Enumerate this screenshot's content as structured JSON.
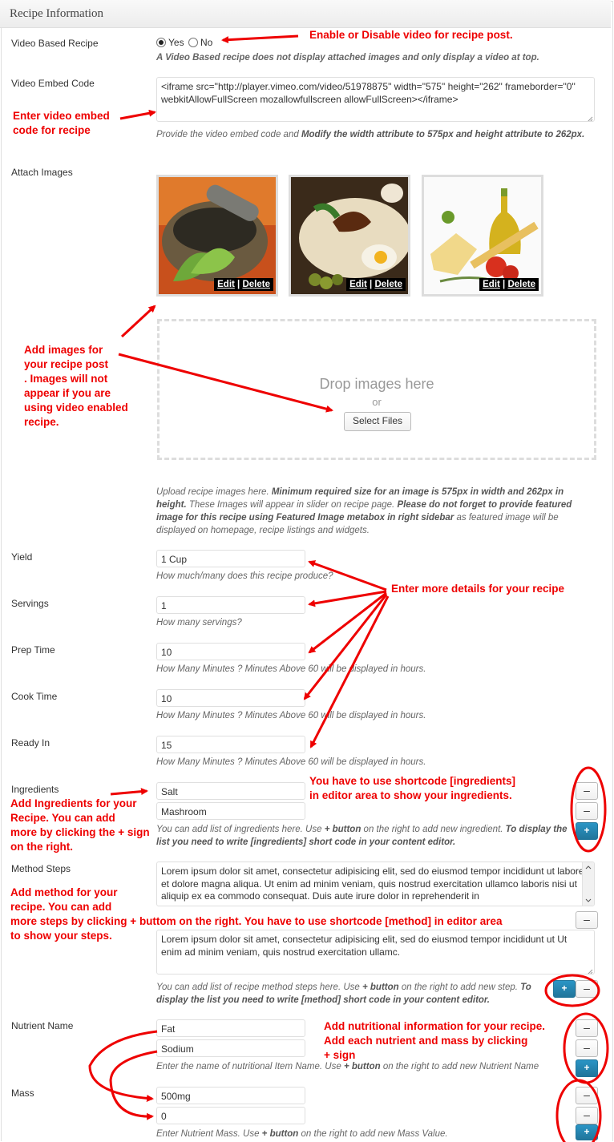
{
  "panel": {
    "title": "Recipe Information"
  },
  "video_based": {
    "label": "Video Based Recipe",
    "yes": "Yes",
    "no": "No",
    "desc": "A Video Based recipe does not display attached images and only display a video at top."
  },
  "embed": {
    "label": "Video Embed Code",
    "value": "<iframe src=\"http://player.vimeo.com/video/51978875\" width=\"575\" height=\"262\" frameborder=\"0\" webkitAllowFullScreen mozallowfullscreen allowFullScreen></iframe>",
    "desc_a": "Provide the video embed code and ",
    "desc_b": "Modify the width attribute to 575px and height attribute to 262px."
  },
  "images": {
    "label": "Attach Images",
    "edit": "Edit",
    "sep": " | ",
    "delete": "Delete",
    "drop_title": "Drop images here",
    "drop_or": "or",
    "select_files": "Select Files",
    "desc_a": "Upload recipe images here. ",
    "desc_b": "Minimum required size for an image is 575px in width and 262px in height.",
    "desc_c": " These Images will appear in slider on recipe page. ",
    "desc_d": "Please do not forget to provide featured image for this recipe using Featured Image metabox in right sidebar",
    "desc_e": " as featured image will be displayed on homepage, recipe listings and widgets."
  },
  "yield": {
    "label": "Yield",
    "value": "1 Cup",
    "desc": "How much/many does this recipe produce?"
  },
  "servings": {
    "label": "Servings",
    "value": "1",
    "desc": "How many servings?"
  },
  "prep": {
    "label": "Prep Time",
    "value": "10",
    "desc": "How Many Minutes ? Minutes Above 60 will be displayed in hours."
  },
  "cook": {
    "label": "Cook Time",
    "value": "10",
    "desc": "How Many Minutes ? Minutes Above 60 will be displayed in hours."
  },
  "ready": {
    "label": "Ready In",
    "value": "15",
    "desc": "How Many Minutes ? Minutes Above 60 will be displayed in hours."
  },
  "ingredients": {
    "label": "Ingredients",
    "items": [
      "Salt",
      "Mashroom"
    ],
    "desc_a": "You can add list of ingredients here. Use ",
    "desc_b": "+ button",
    "desc_c": " on the right to add new ingredient. ",
    "desc_d": "To display the list you need to write [ingredients] short code in your content editor."
  },
  "method": {
    "label": "Method Steps",
    "steps": [
      "Lorem ipsum dolor sit amet, consectetur adipisicing elit, sed do eiusmod tempor incididunt ut labore et dolore magna aliqua. Ut enim ad minim veniam, quis nostrud exercitation ullamco laboris nisi ut aliquip ex ea commodo consequat. Duis aute irure dolor in reprehenderit in",
      "Lorem ipsum dolor sit amet, consectetur adipisicing elit, sed do eiusmod tempor incididunt ut Ut enim ad minim veniam, quis nostrud exercitation ullamc."
    ],
    "desc_a": "You can add list of recipe method steps here. Use ",
    "desc_b": "+ button",
    "desc_c": " on the right to add new step. ",
    "desc_d": "To display the list you need to write [method] short code in your content editor."
  },
  "nutrient": {
    "label": "Nutrient Name",
    "items": [
      "Fat",
      "Sodium"
    ],
    "desc_a": "Enter the name of nutritional Item Name. Use ",
    "desc_b": "+ button",
    "desc_c": " on the right to add new Nutrient Name"
  },
  "mass": {
    "label": "Mass",
    "items": [
      "500mg",
      "0"
    ],
    "desc_a": "Enter Nutrient Mass. Use ",
    "desc_b": "+ button",
    "desc_c": " on the right to add new Mass Value."
  },
  "buttons": {
    "minus": "–",
    "plus": "+"
  },
  "notes": {
    "video": "Enable or Disable video for recipe post.",
    "embed": [
      "Enter video embed",
      "code for recipe"
    ],
    "images": [
      "Add images for",
      "your recipe post",
      ". Images will not",
      "appear if you are",
      "using video enabled",
      "recipe."
    ],
    "details": "Enter more details for your recipe",
    "shortcode_ing": [
      "You have to use shortcode [ingredients]",
      "in editor area to show your ingredients."
    ],
    "ingredients": [
      "Add Ingredients for your",
      "Recipe. You can add",
      "more by clicking the + sign",
      "on the right."
    ],
    "method": [
      "Add method for your",
      "recipe. You can add",
      "more steps by clicking + buttom on the right. You have to use shortcode [method] in editor area",
      "to show your steps."
    ],
    "nutrition": [
      "Add nutritional information for your recipe.",
      "Add each nutrient and mass by clicking",
      "+ sign"
    ]
  },
  "colors": {
    "annotation": "#e00000",
    "primary_button": "#21759b"
  }
}
